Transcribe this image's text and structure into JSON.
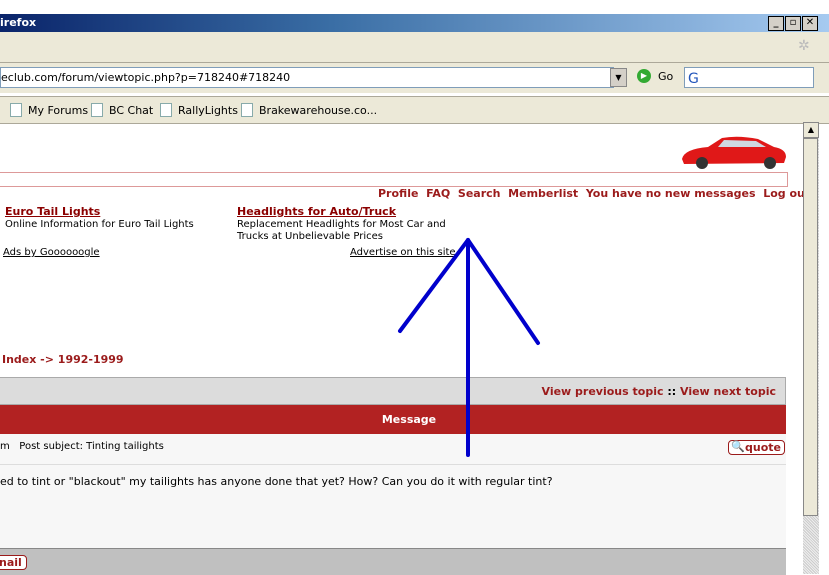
{
  "window": {
    "title": "irefox"
  },
  "address": {
    "url": "eclub.com/forum/viewtopic.php?p=718240#718240",
    "go_label": "Go"
  },
  "bookmarks": [
    "My Forums",
    "BC Chat",
    "RallyLights",
    "Brakewarehouse.co..."
  ],
  "nav": [
    "Profile",
    "FAQ",
    "Search",
    "Memberlist",
    "You have no new messages",
    "Log out"
  ],
  "ads": [
    {
      "title": "Euro Tail Lights",
      "desc": "Online Information for Euro Tail Lights"
    },
    {
      "title": "Headlights for Auto/Truck",
      "desc": "Replacement Headlights for Most Car and Trucks at Unbelievable Prices"
    }
  ],
  "ads_by": "Ads by Goooooogle",
  "advertise": "Advertise on this site",
  "breadcrumb": "Index -> 1992-1999",
  "topic_nav": {
    "prev": "View previous topic",
    "sep": "::",
    "next": "View next topic"
  },
  "table_header": "Message",
  "post": {
    "meta": "m   Post subject: Tinting tailights",
    "quote": "quote",
    "body": "ed to tint or \"blackout\" my tailights has anyone done that yet? How? Can you do it with regular tint?",
    "email": "nail"
  },
  "colors": {
    "accent": "#b22222",
    "link": "#9b1b1b",
    "arrow": "#0000cc"
  }
}
